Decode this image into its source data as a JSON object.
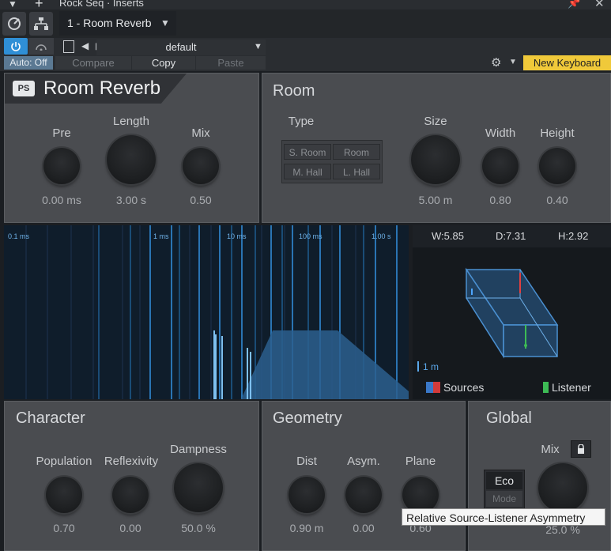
{
  "window": {
    "title": "Rock Seq · Inserts"
  },
  "header": {
    "preset_slot": "1 - Room Reverb",
    "preset_name": "default",
    "auto_label": "Auto: Off",
    "compare_label": "Compare",
    "copy_label": "Copy",
    "paste_label": "Paste",
    "keyboard_label": "New Keyboard"
  },
  "plugin": {
    "name": "Room Reverb",
    "logo_text": "PS",
    "main": {
      "pre": {
        "label": "Pre",
        "value": "0.00 ms"
      },
      "length": {
        "label": "Length",
        "value": "3.00 s"
      },
      "mix": {
        "label": "Mix",
        "value": "0.50"
      }
    },
    "room": {
      "title": "Room",
      "type_label": "Type",
      "types": [
        "S. Room",
        "Room",
        "M. Hall",
        "L. Hall"
      ],
      "size": {
        "label": "Size",
        "value": "5.00 m"
      },
      "width": {
        "label": "Width",
        "value": "0.80"
      },
      "height": {
        "label": "Height",
        "value": "0.40"
      }
    },
    "graph": {
      "time_labels": [
        "0.1 ms",
        "1 ms",
        "10 ms",
        "100 ms",
        "1.00 s"
      ]
    },
    "room3d": {
      "w": "W:5.85",
      "d": "D:7.31",
      "h": "H:2.92",
      "scale": "1 m",
      "sources_label": "Sources",
      "listener_label": "Listener"
    },
    "character": {
      "title": "Character",
      "population": {
        "label": "Population",
        "value": "0.70"
      },
      "reflexivity": {
        "label": "Reflexivity",
        "value": "0.00"
      },
      "dampness": {
        "label": "Dampness",
        "value": "50.0 %"
      }
    },
    "geometry": {
      "title": "Geometry",
      "dist": {
        "label": "Dist",
        "value": "0.90 m"
      },
      "asym": {
        "label": "Asym.",
        "value": "0.00"
      },
      "plane": {
        "label": "Plane",
        "value": "0.60"
      }
    },
    "global": {
      "title": "Global",
      "mix": {
        "label": "Mix",
        "value": "25.0 %"
      },
      "eco_label": "Eco",
      "mode_label": "Mode"
    }
  },
  "tooltip": "Relative Source-Listener Asymmetry",
  "colors": {
    "accent": "#2f8fd6",
    "keyboard": "#f0c93a",
    "panel": "#4a4c50"
  }
}
